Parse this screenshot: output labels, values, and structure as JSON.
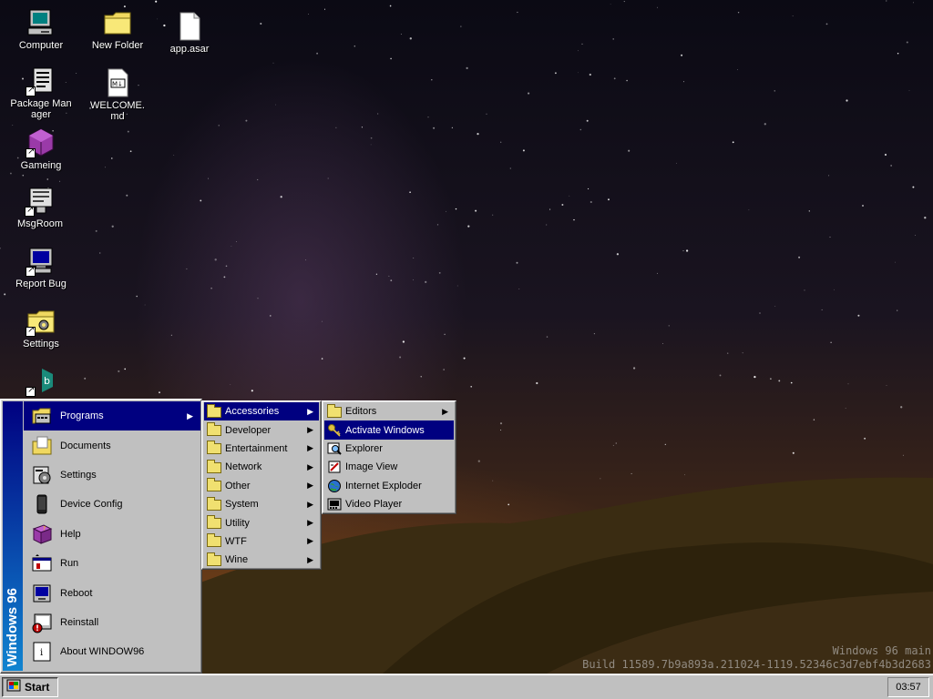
{
  "desktop": {
    "icons": [
      {
        "label": "Computer",
        "icon": "computer-icon"
      },
      {
        "label": "New Folder",
        "icon": "folder-icon"
      },
      {
        "label": "app.asar",
        "icon": "file-icon"
      },
      {
        "label": "Package Manager",
        "icon": "package-manager-icon"
      },
      {
        "label": "WELCOME.md",
        "icon": "markdown-file-icon"
      },
      {
        "label": "Gameing",
        "icon": "cube-icon"
      },
      {
        "label": "MsgRoom",
        "icon": "chat-icon"
      },
      {
        "label": "Report Bug",
        "icon": "monitor-icon"
      },
      {
        "label": "Settings",
        "icon": "settings-folder-icon"
      },
      {
        "label": "",
        "icon": "b-app-icon"
      }
    ],
    "watermark": {
      "line1": "Windows 96 main",
      "line2": "Build 11589.7b9a893a.211024-1119.52346c3d7ebf4b3d2683"
    }
  },
  "start_menu": {
    "banner": "Windows 96",
    "items": [
      {
        "label": "Programs",
        "icon": "programs-icon",
        "has_submenu": true,
        "active": true
      },
      {
        "label": "Documents",
        "icon": "documents-icon"
      },
      {
        "label": "Settings",
        "icon": "settings-icon"
      },
      {
        "label": "Device Config",
        "icon": "device-icon"
      },
      {
        "label": "Help",
        "icon": "help-book-icon"
      },
      {
        "label": "Run",
        "icon": "run-icon"
      },
      {
        "label": "Reboot",
        "icon": "reboot-icon"
      },
      {
        "label": "Reinstall",
        "icon": "reinstall-icon"
      },
      {
        "label": "About WINDOW96",
        "icon": "about-icon"
      }
    ]
  },
  "programs_menu": {
    "items": [
      {
        "label": "Accessories",
        "active": true
      },
      {
        "label": "Developer"
      },
      {
        "label": "Entertainment"
      },
      {
        "label": "Network"
      },
      {
        "label": "Other"
      },
      {
        "label": "System"
      },
      {
        "label": "Utility"
      },
      {
        "label": "WTF"
      },
      {
        "label": "Wine"
      }
    ]
  },
  "accessories_menu": {
    "items": [
      {
        "label": "Editors",
        "icon": "folder-icon",
        "has_submenu": true
      },
      {
        "label": "Activate Windows",
        "icon": "key-icon",
        "active": true
      },
      {
        "label": "Explorer",
        "icon": "magnifier-icon"
      },
      {
        "label": "Image View",
        "icon": "image-view-icon"
      },
      {
        "label": "Internet Exploder",
        "icon": "globe-icon"
      },
      {
        "label": "Video Player",
        "icon": "video-player-icon"
      }
    ]
  },
  "taskbar": {
    "start_label": "Start",
    "clock": "03:57"
  },
  "colors": {
    "highlight": "#000080",
    "face": "#c0c0c0",
    "banner_top": "#000080",
    "banner_bottom": "#1084d0"
  }
}
